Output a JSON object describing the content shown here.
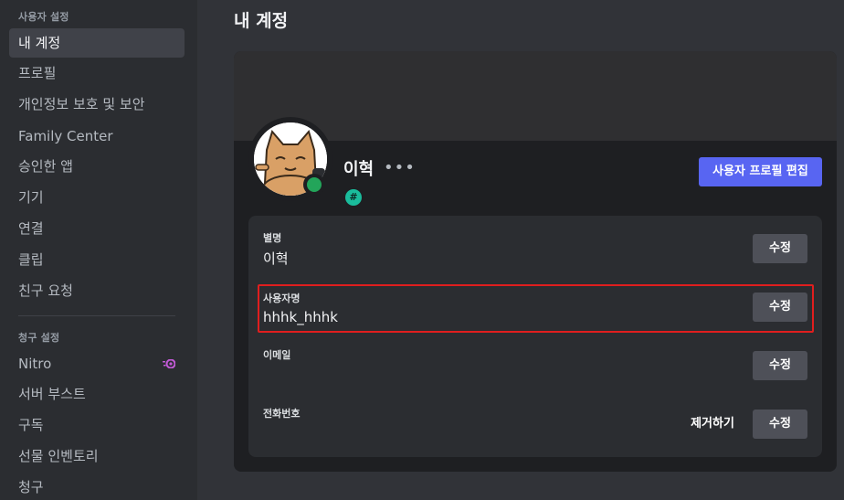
{
  "sidebar": {
    "section_user": "사용자 설정",
    "items": [
      {
        "label": "내 계정",
        "active": true
      },
      {
        "label": "프로필"
      },
      {
        "label": "개인정보 보호 및 보안"
      },
      {
        "label": "Family Center"
      },
      {
        "label": "승인한 앱"
      },
      {
        "label": "기기"
      },
      {
        "label": "연결"
      },
      {
        "label": "클립"
      },
      {
        "label": "친구 요청"
      }
    ],
    "section_billing": "청구 설정",
    "billing_items": [
      {
        "label": "Nitro",
        "icon": "nitro-icon"
      },
      {
        "label": "서버 부스트"
      },
      {
        "label": "구독"
      },
      {
        "label": "선물 인벤토리"
      },
      {
        "label": "청구"
      }
    ]
  },
  "main": {
    "title": "내 계정",
    "profile": {
      "display_name": "이혁",
      "more_label": "•••",
      "badge": "#",
      "edit_profile_label": "사용자 프로필 편집"
    },
    "fields": [
      {
        "label": "별명",
        "value": "이혁",
        "edit_label": "수정"
      },
      {
        "label": "사용자명",
        "value": "hhhk_hhhk",
        "edit_label": "수정"
      },
      {
        "label": "이메일",
        "value": "",
        "edit_label": "수정"
      },
      {
        "label": "전화번호",
        "value": "",
        "remove_label": "제거하기",
        "edit_label": "수정"
      }
    ]
  },
  "colors": {
    "accent": "#5865f2",
    "online": "#23a55a",
    "highlight": "#e01e1e"
  }
}
